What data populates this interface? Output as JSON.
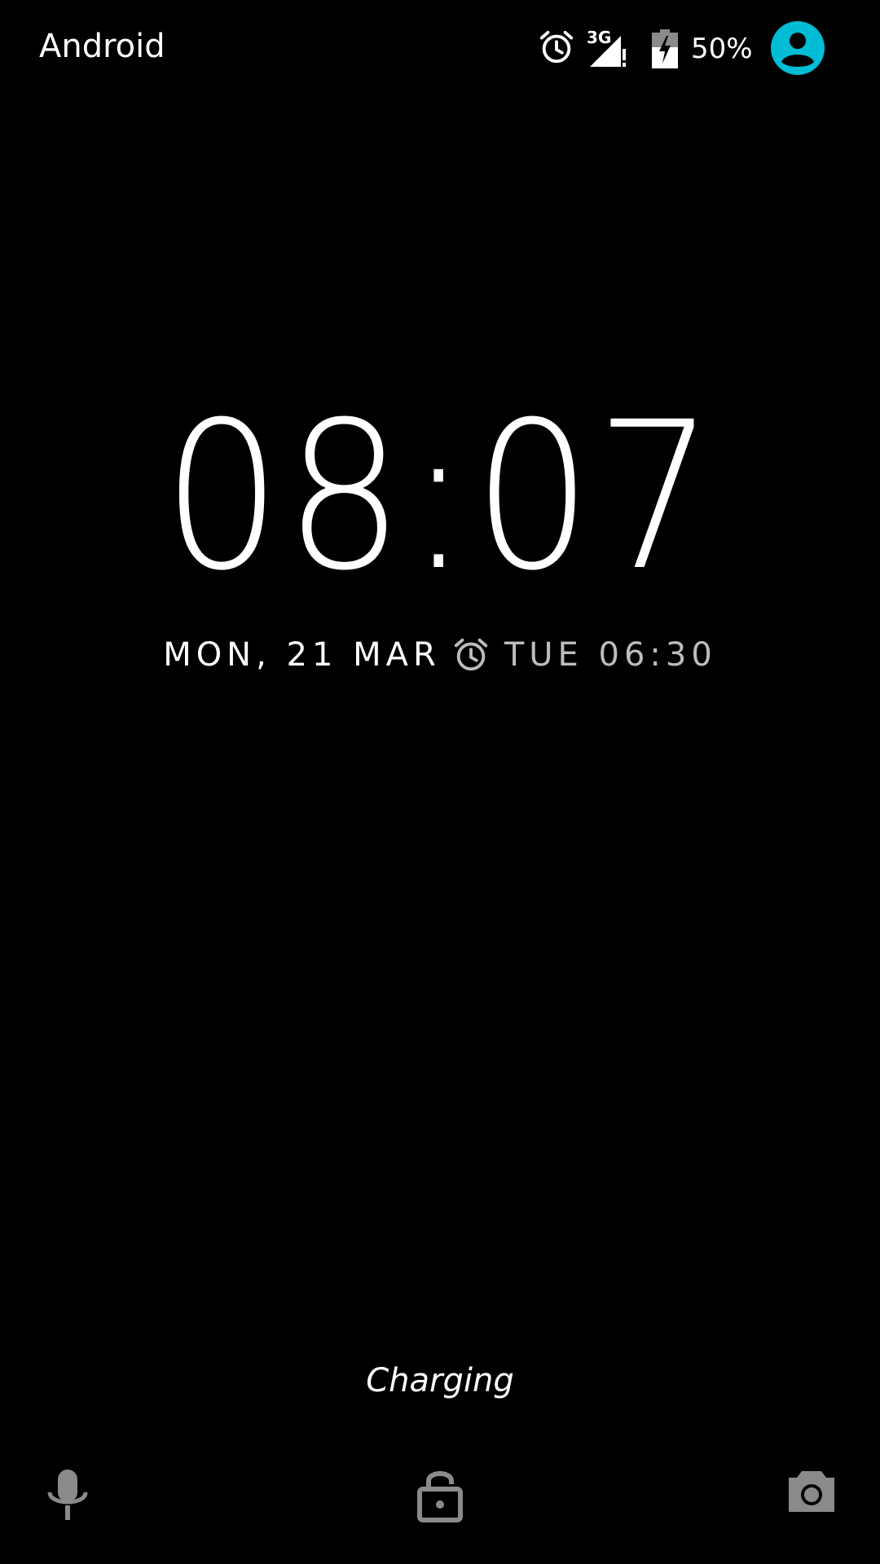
{
  "status_bar": {
    "carrier": "Android",
    "network_type": "3G",
    "battery_percent": "50%",
    "icons": [
      "alarm-icon",
      "signal-icon",
      "battery-charging-icon",
      "user-avatar-icon"
    ],
    "avatar_color": "#00bcd4"
  },
  "lockscreen": {
    "time": "08:07",
    "date": "MON, 21 MAR",
    "next_alarm": "TUE 06:30",
    "status": "Charging"
  },
  "bottom_actions": {
    "left_icon": "microphone-icon",
    "center_icon": "lock-icon",
    "right_icon": "camera-icon"
  }
}
